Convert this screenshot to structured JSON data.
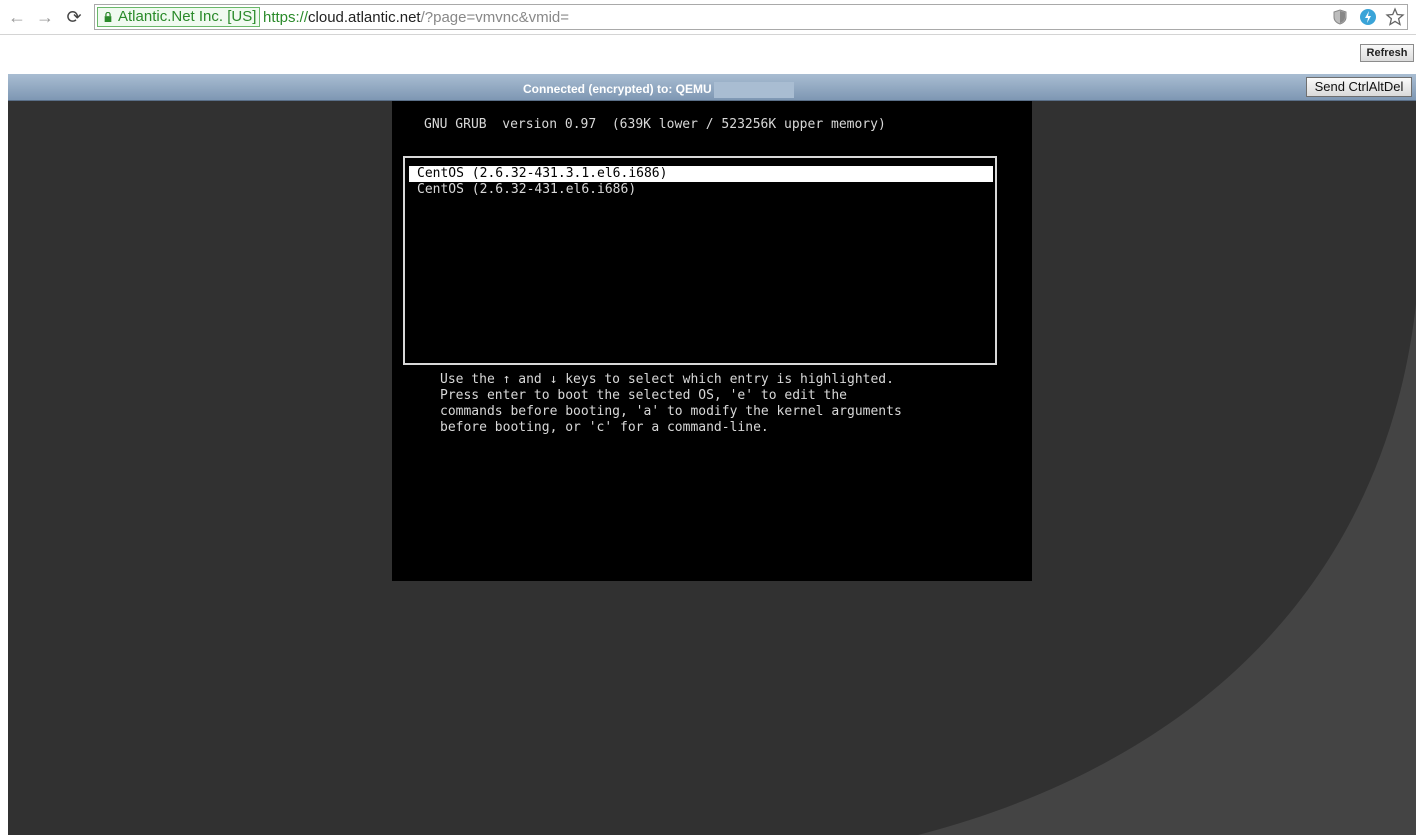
{
  "browser": {
    "ev_org": "Atlantic.Net Inc. [US]",
    "url_scheme": "https://",
    "url_host": "cloud.atlantic.net",
    "url_path": "/?page=vmvnc&vmid="
  },
  "page": {
    "refresh_label": "Refresh"
  },
  "vnc": {
    "status": "Connected (encrypted) to: QEMU",
    "ctrlaltdel_label": "Send CtrlAltDel"
  },
  "grub": {
    "header": "GNU GRUB  version 0.97  (639K lower / 523256K upper memory)",
    "entries": [
      {
        "label": "CentOS (2.6.32-431.3.1.el6.i686)",
        "selected": true
      },
      {
        "label": "CentOS (2.6.32-431.el6.i686)",
        "selected": false
      }
    ],
    "help": [
      "Use the ↑ and ↓ keys to select which entry is highlighted.",
      "Press enter to boot the selected OS, 'e' to edit the",
      "commands before booting, 'a' to modify the kernel arguments",
      "before booting, or 'c' for a command-line."
    ]
  },
  "colors": {
    "ev_green": "#2a8a2a",
    "vnc_bg": "#313131",
    "vnc_curve": "#444444",
    "status_bar": "#8ea6c0"
  }
}
